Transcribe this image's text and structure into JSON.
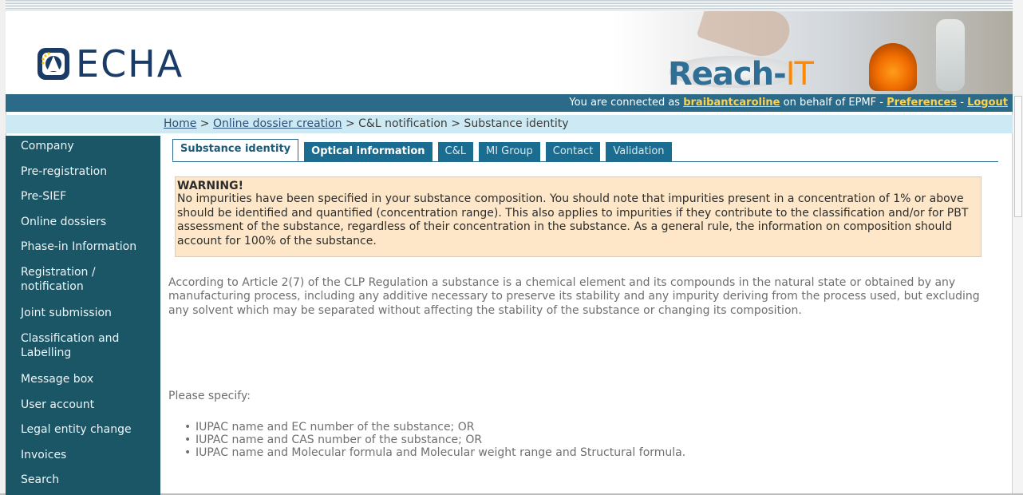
{
  "header": {
    "logo_text": "ECHA",
    "reach_prefix": "Reach-",
    "reach_suffix": "IT"
  },
  "status": {
    "connected_prefix": "You are connected as ",
    "username": "braibantcaroline",
    "behalf_text": " on behalf of EPMF - ",
    "preferences": "Preferences",
    "separator": " - ",
    "logout": "Logout",
    "link_color": "#ffd24a"
  },
  "breadcrumb": {
    "home": "Home",
    "sep1": " > ",
    "online_dossier": "Online dossier creation",
    "sep2": " > C&L notification > Substance identity"
  },
  "sidebar": {
    "items": [
      {
        "label": "Company"
      },
      {
        "label": "Pre-registration"
      },
      {
        "label": "Pre-SIEF"
      },
      {
        "label": "Online dossiers"
      },
      {
        "label": "Phase-in Information"
      },
      {
        "label": "Registration / notification"
      },
      {
        "label": "Joint submission"
      },
      {
        "label": "Classification and Labelling"
      },
      {
        "label": "Message box"
      },
      {
        "label": "User account"
      },
      {
        "label": "Legal entity change"
      },
      {
        "label": "Invoices"
      },
      {
        "label": "Search"
      }
    ]
  },
  "tabs": [
    {
      "label": "Substance identity",
      "state": "active"
    },
    {
      "label": "Optical information",
      "state": "bold"
    },
    {
      "label": "C&L",
      "state": "normal"
    },
    {
      "label": "MI Group",
      "state": "normal"
    },
    {
      "label": "Contact",
      "state": "normal"
    },
    {
      "label": "Validation",
      "state": "normal"
    }
  ],
  "warning": {
    "title": "WARNING!",
    "body": "No impurities have been specified in your substance composition. You should note that impurities present in a concentration of 1% or above should be identified and quantified (concentration range). This also applies to impurities if they contribute to the classification and/or for PBT assessment of the substance, regardless of their concentration in the substance. As a general rule, the information on composition should account for 100% of the substance."
  },
  "content": {
    "definition": "According to Article 2(7) of the CLP Regulation a substance is a chemical element and its compounds in the natural state or obtained by any manufacturing process, including any additive necessary to preserve its stability and any impurity deriving from the process used, but excluding any solvent which may be separated without affecting the stability of the substance or changing its composition.",
    "specify_label": "Please specify:",
    "options": [
      "IUPAC name and EC number of the substance; OR",
      "IUPAC name and CAS number of the substance; OR",
      "IUPAC name and Molecular formula and Molecular weight range and Structural formula."
    ]
  },
  "colors": {
    "sidebar_bg": "#1b5667",
    "status_bg": "#2b6a89",
    "tab_bg": "#1a6d90",
    "warning_bg": "#fde7c8",
    "crumb_bg": "#cde9f3",
    "reach_blue": "#2f6f95",
    "reach_orange": "#ff8a00",
    "logo_navy": "#1a3b66"
  }
}
